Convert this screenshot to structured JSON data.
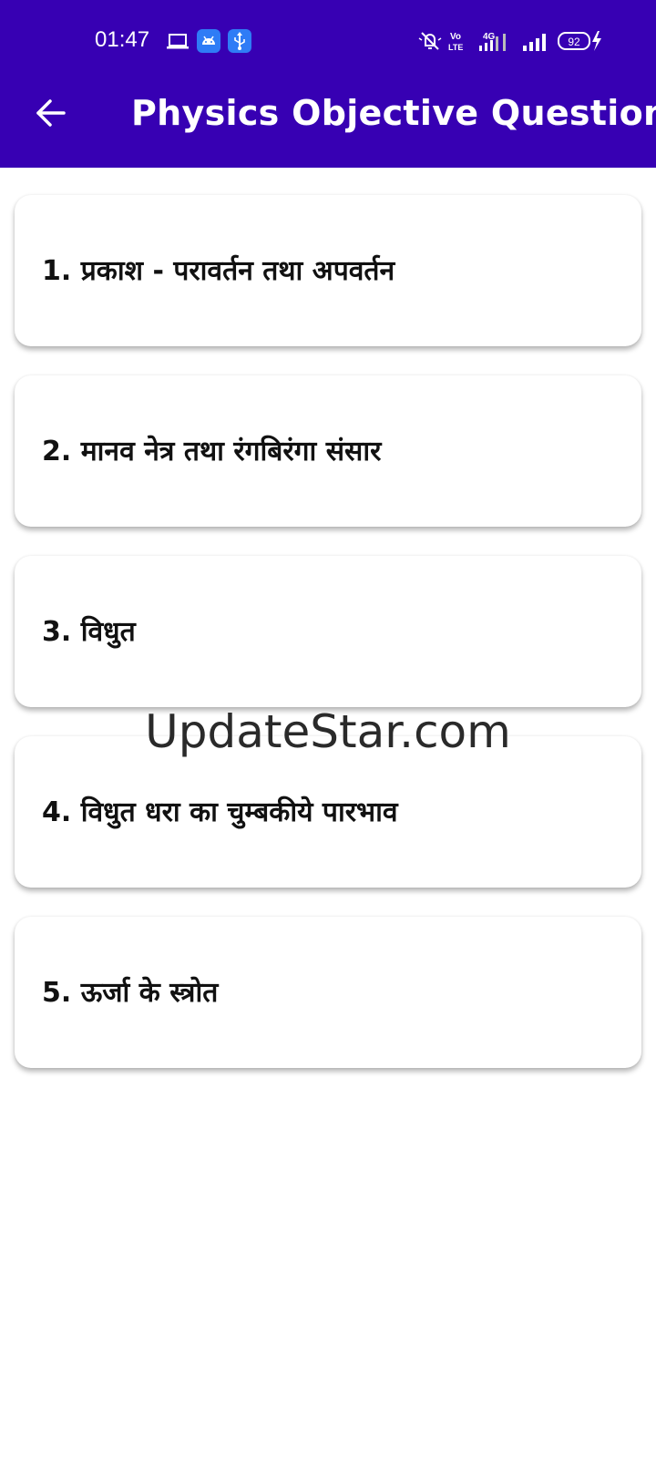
{
  "status_bar": {
    "time": "01:47",
    "battery_level": "92",
    "network_label": "4G",
    "volte_label": "Vo LTE"
  },
  "app_bar": {
    "title": "Physics Objective Question"
  },
  "chapters": [
    {
      "label": "1. प्रकाश - परावर्तन तथा अपवर्तन"
    },
    {
      "label": "2. मानव नेत्र तथा रंगबिरंगा संसार"
    },
    {
      "label": "3. विधुत"
    },
    {
      "label": "4. विधुत धरा का चुम्बकीये पारभाव"
    },
    {
      "label": "5. ऊर्जा के स्त्रोत"
    }
  ],
  "watermark": "UpdateStar.com",
  "colors": {
    "app_bar": "#3700b3",
    "status_badge": "#2f7cf6"
  }
}
